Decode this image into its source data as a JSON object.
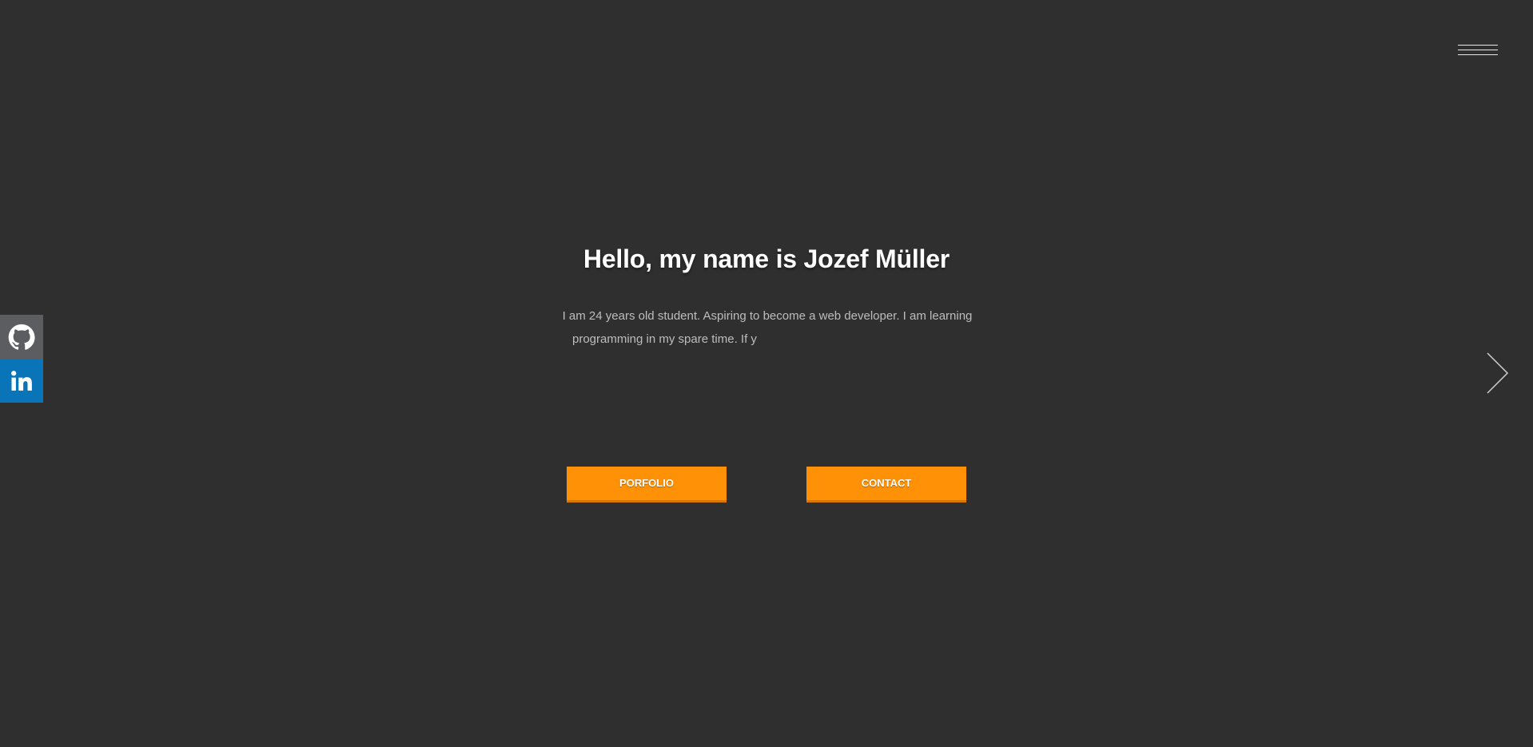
{
  "hero": {
    "title": "Hello, my name is Jozef Müller",
    "description_line1": "I am 24 years old student. Aspiring to become a web developer. I am learning",
    "description_line2": "programming in my spare time. If y"
  },
  "buttons": {
    "portfolio_label": "PORFOLIO",
    "contact_label": "CONTACT"
  },
  "social": {
    "github_icon": "github-icon",
    "linkedin_icon": "linkedin-icon"
  },
  "navigation": {
    "menu_icon": "hamburger-menu-icon",
    "next_icon": "chevron-right-icon"
  },
  "colors": {
    "background": "#2f2f2f",
    "accent": "#ff9106",
    "github": "#5c5d60",
    "linkedin": "#0a74b8"
  }
}
